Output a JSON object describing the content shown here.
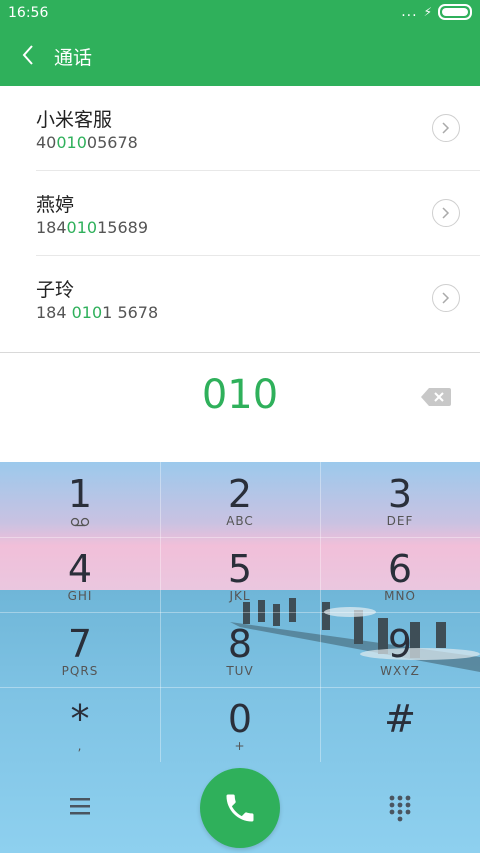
{
  "status": {
    "time": "16:56",
    "dots": "...",
    "bolt": "⚡"
  },
  "header": {
    "title": "通话"
  },
  "contacts": [
    {
      "name": "小米客服",
      "num_pre": "40",
      "num_hl": "010",
      "num_post": "05678"
    },
    {
      "name": "燕婷",
      "num_pre": "184",
      "num_hl": "010",
      "num_post": "15689"
    },
    {
      "name": "子玲",
      "num_pre": "184 ",
      "num_hl": "010",
      "num_post": "1 5678"
    }
  ],
  "dialed_number": "010",
  "keypad": [
    {
      "digit": "1",
      "letters": ""
    },
    {
      "digit": "2",
      "letters": "ABC"
    },
    {
      "digit": "3",
      "letters": "DEF"
    },
    {
      "digit": "4",
      "letters": "GHI"
    },
    {
      "digit": "5",
      "letters": "JKL"
    },
    {
      "digit": "6",
      "letters": "MNO"
    },
    {
      "digit": "7",
      "letters": "PQRS"
    },
    {
      "digit": "8",
      "letters": "TUV"
    },
    {
      "digit": "9",
      "letters": "WXYZ"
    },
    {
      "digit": "*",
      "letters": ","
    },
    {
      "digit": "0",
      "letters": "+"
    },
    {
      "digit": "#",
      "letters": ""
    }
  ],
  "colors": {
    "accent": "#2fb05b"
  },
  "icons": {
    "back": "chevron-left-icon",
    "voicemail": "voicemail-icon",
    "menu": "menu-icon",
    "call": "phone-icon",
    "dialpad": "dialpad-icon",
    "backspace": "backspace-icon"
  }
}
